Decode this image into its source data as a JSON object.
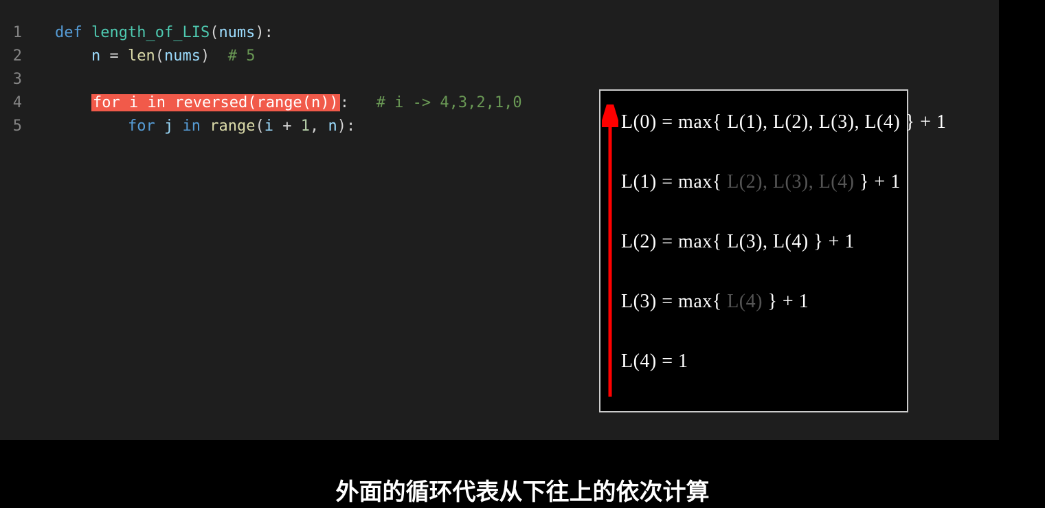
{
  "lines": {
    "n1": "1",
    "n2": "2",
    "n3": "3",
    "n4": "4",
    "n5": "5"
  },
  "code": {
    "l1": {
      "def": "def",
      "fn": "length_of_LIS",
      "open": "(",
      "p": "nums",
      "close": "):"
    },
    "l2": {
      "indent": "    ",
      "lhs": "n",
      "eq": " = ",
      "fn": "len",
      "open": "(",
      "arg": "nums",
      "close": ")  ",
      "comment": "# 5"
    },
    "l4": {
      "indent": "    ",
      "hl_for": "for",
      "hl_sp1": " ",
      "hl_i": "i",
      "hl_sp2": " ",
      "hl_in": "in",
      "hl_sp3": " ",
      "hl_rev": "reversed",
      "hl_open": "(",
      "hl_range": "range",
      "hl_open2": "(",
      "hl_n": "n",
      "hl_close": "))",
      "colon": ":",
      "pad": "   ",
      "comment": "# i -> 4,3,2,1,0"
    },
    "l5": {
      "indent": "        ",
      "for": "for",
      "sp1": " ",
      "j": "j",
      "sp2": " ",
      "in": "in",
      "sp3": " ",
      "range": "range",
      "open": "(",
      "i": "i",
      "plus": " + ",
      "one": "1",
      "comma": ", ",
      "n": "n",
      "close": "):"
    }
  },
  "formulas": {
    "r0_a": "L(0) = max{ L(1), L(2), L(3), L(4) } + 1",
    "r1_a": "L(1) = max{ ",
    "r1_dim": "L(2), L(3), L(4)",
    "r1_b": " } + 1",
    "r2_a": "L(2) = max{ L(3), L(4) } + 1",
    "r3_a": "L(3) = max{ ",
    "r3_dim": "L(4)",
    "r3_b": " } + 1",
    "r4_a": "L(4) = 1"
  },
  "subtitle": "外面的循环代表从下往上的依次计算",
  "colors": {
    "highlight_bg": "#f15a4a",
    "arrow": "#ff0000"
  }
}
